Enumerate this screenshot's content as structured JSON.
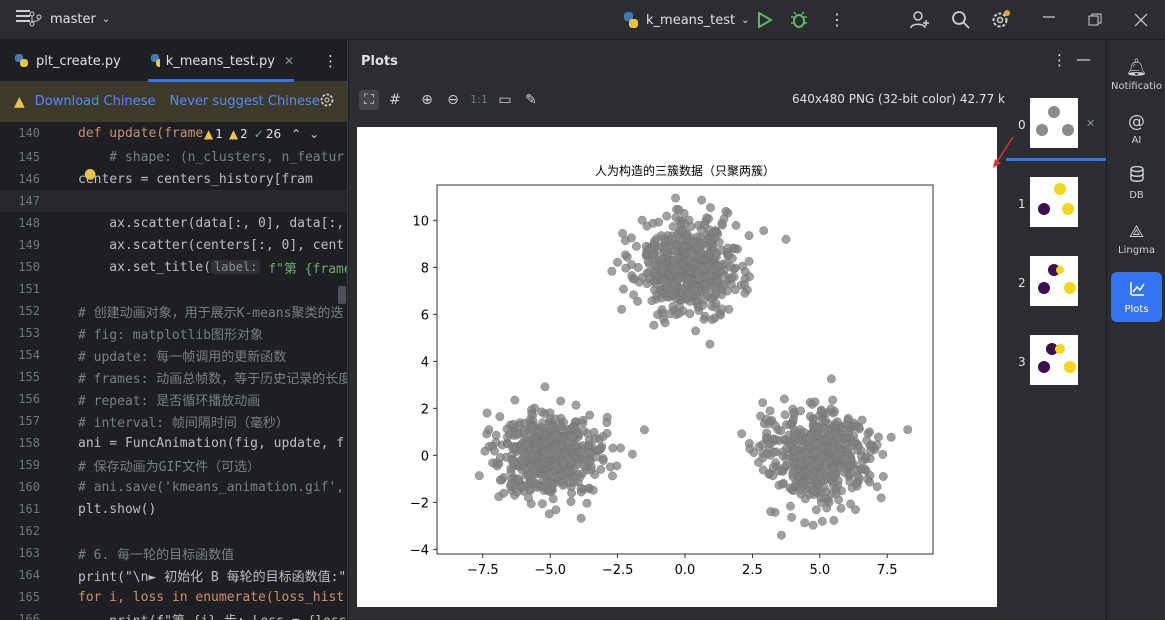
{
  "titlebar": {
    "branch": "master",
    "run_config": "k_means_test"
  },
  "editor": {
    "tabs": [
      {
        "label": "plt_create.py"
      },
      {
        "label": "k_means_test.py"
      }
    ],
    "banner": {
      "download": "Download Chinese",
      "never": "Never suggest Chinese"
    },
    "inspections": {
      "warnings": "1",
      "weak": "2",
      "ok": "26"
    },
    "lines": [
      {
        "n": "140",
        "text": "def update(frame"
      },
      {
        "n": "145",
        "text": "    # shape: (n_clusters, n_featur"
      },
      {
        "n": "146",
        "text": "centers = centers_history[fram"
      },
      {
        "n": "147",
        "text": ""
      },
      {
        "n": "148",
        "text": "    ax.scatter(data[:, 0], data[:,"
      },
      {
        "n": "149",
        "text": "    ax.scatter(centers[:, 0], cent"
      },
      {
        "n": "150",
        "text": "    ax.set_title(",
        "hint": "label:",
        "rest": " f\"第 {frame"
      },
      {
        "n": "151",
        "text": ""
      },
      {
        "n": "152",
        "text": "# 创建动画对象，用于展示K-means聚类的迭"
      },
      {
        "n": "153",
        "text": "# fig: matplotlib图形对象"
      },
      {
        "n": "154",
        "text": "# update: 每一帧调用的更新函数"
      },
      {
        "n": "155",
        "text": "# frames: 动画总帧数，等于历史记录的长度"
      },
      {
        "n": "156",
        "text": "# repeat: 是否循环播放动画"
      },
      {
        "n": "157",
        "text": "# interval: 帧间隔时间（毫秒）"
      },
      {
        "n": "158",
        "text": "ani = FuncAnimation(fig, update, f"
      },
      {
        "n": "159",
        "text": "# 保存动画为GIF文件（可选）"
      },
      {
        "n": "160",
        "text": "# ani.save('kmeans_animation.gif',"
      },
      {
        "n": "161",
        "text": "plt.show()"
      },
      {
        "n": "162",
        "text": ""
      },
      {
        "n": "163",
        "text": "# 6. 每一轮的目标函数值"
      },
      {
        "n": "164",
        "text": "print(\"\\n► 初始化 B 每轮的目标函数值:\""
      },
      {
        "n": "165",
        "text": "for i, loss in enumerate(loss_hist"
      },
      {
        "n": "166",
        "text": "    print(f\"第 {i} 步: Loss = {loss"
      }
    ]
  },
  "plots": {
    "title": "Plots",
    "info": "640x480 PNG (32-bit color) 42.77 kB",
    "zoom_label": "1:1",
    "thumbnails": [
      {
        "n": "0"
      },
      {
        "n": "1"
      },
      {
        "n": "2"
      },
      {
        "n": "3"
      }
    ]
  },
  "rightbar": [
    {
      "label": "Notifications",
      "icon": "bell-icon"
    },
    {
      "label": "AI",
      "icon": "ai-spiral-icon"
    },
    {
      "label": "DB",
      "icon": "database-icon"
    },
    {
      "label": "Lingma",
      "icon": "lingma-icon"
    },
    {
      "label": "Plots",
      "icon": "plots-icon"
    }
  ],
  "chart_data": {
    "type": "scatter",
    "title": "人为构造的三簇数据（只聚两簇）",
    "xlabel": "",
    "ylabel": "",
    "xlim": [
      -9.2,
      9.2
    ],
    "ylim": [
      -4.2,
      11.5
    ],
    "xticks": [
      "−7.5",
      "−5.0",
      "−2.5",
      "0.0",
      "2.5",
      "5.0",
      "7.5"
    ],
    "yticks": [
      "−4",
      "−2",
      "0",
      "2",
      "4",
      "6",
      "8",
      "10"
    ],
    "xtick_values": [
      -7.5,
      -5.0,
      -2.5,
      0.0,
      2.5,
      5.0,
      7.5
    ],
    "ytick_values": [
      -4,
      -2,
      0,
      2,
      4,
      6,
      8,
      10
    ],
    "point_color": "#808080",
    "clusters": [
      {
        "center": [
          -5.0,
          0.0
        ],
        "spread": 1.0,
        "count": 500
      },
      {
        "center": [
          0.0,
          8.0
        ],
        "spread": 1.0,
        "count": 500
      },
      {
        "center": [
          5.0,
          0.0
        ],
        "spread": 1.0,
        "count": 500
      }
    ]
  }
}
